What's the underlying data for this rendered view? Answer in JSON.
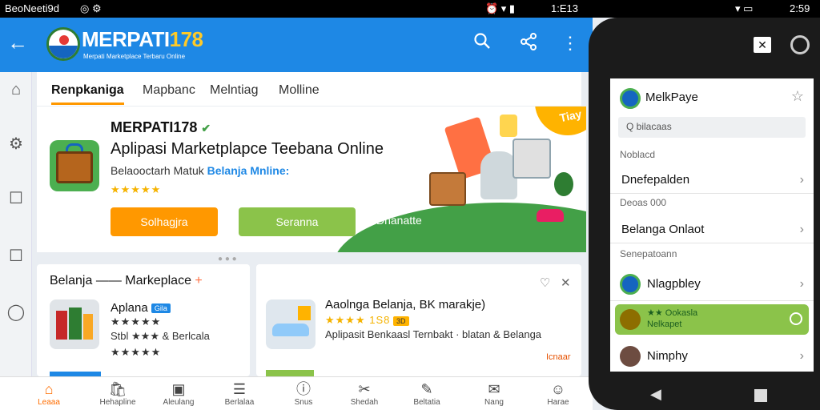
{
  "status": {
    "left_text": "BeoNeeti9d",
    "center_time": "1:E13",
    "right_time": "2:59"
  },
  "appbar": {
    "brand": "MERPATI",
    "brand_num": "178",
    "brand_sub": "Merpati Marketplace Terbaru Online"
  },
  "tabs": [
    "Renpkaniga",
    "Mapbanc",
    "Melntiag",
    "Molline"
  ],
  "hero": {
    "title": "MERPATI178",
    "headline": "Aplipasi Marketplapce Teebana Online",
    "sub_prefix": "Belaooctarh Matuk",
    "sub_highlight": "Belanja Mnline:",
    "stars": "★★★★★",
    "btn_primary": "Solhagjra",
    "btn_secondary": "Seranna",
    "btn_link": "Dhanatte",
    "tag_text": "Tiay"
  },
  "card_left": {
    "title": "Belanja —— Markeplace",
    "arrow": "+",
    "item_name": "Aplana",
    "item_badge": "Gila",
    "item_line2": "Stbl ★★★ & Berlcala",
    "stars": "★★★★★"
  },
  "card_right": {
    "title": "Aaolnga Belanja, BK marakje)",
    "rating": "★★★★ 1S8",
    "rating_badge": "3D",
    "description": "Aplipasit Benkaasl Ternbakt · blatan & Belanga",
    "corner_text": "Icnaar"
  },
  "bottom_nav": [
    {
      "label": "Leaaa",
      "icon": "home-icon",
      "glyph": "⌂"
    },
    {
      "label": "Hehapline",
      "icon": "cart-icon",
      "glyph": "🛍"
    },
    {
      "label": "Aleulang",
      "icon": "wallet-icon",
      "glyph": "▣"
    },
    {
      "label": "Berlalaa",
      "icon": "list-icon",
      "glyph": "☰"
    },
    {
      "label": "Snus",
      "icon": "info-icon",
      "glyph": "ⓘ"
    },
    {
      "label": "Shedah",
      "icon": "tools-icon",
      "glyph": "✂"
    },
    {
      "label": "Beltatia",
      "icon": "edit-icon",
      "glyph": "✎"
    },
    {
      "label": "Nang",
      "icon": "message-icon",
      "glyph": "✉"
    },
    {
      "label": "Harae",
      "icon": "profile-icon",
      "glyph": "☺"
    }
  ],
  "phone": {
    "header_title": "MelkPaye",
    "search_text": "Q bilacaas",
    "section1_label": "Noblacd",
    "row1": "Dnefepalden",
    "section2_label": "Deoas 000",
    "row2": "Belanga Onlaot",
    "section3_label": "Senepatoann",
    "row3": "Nlagpbley",
    "highlight_line1": "★★ Ookasla",
    "highlight_line2": "Nelkapet",
    "row4": "Nimphy"
  },
  "colors": {
    "primary_blue": "#1e88e5",
    "accent_orange": "#ff9800",
    "accent_green": "#8bc34a"
  }
}
